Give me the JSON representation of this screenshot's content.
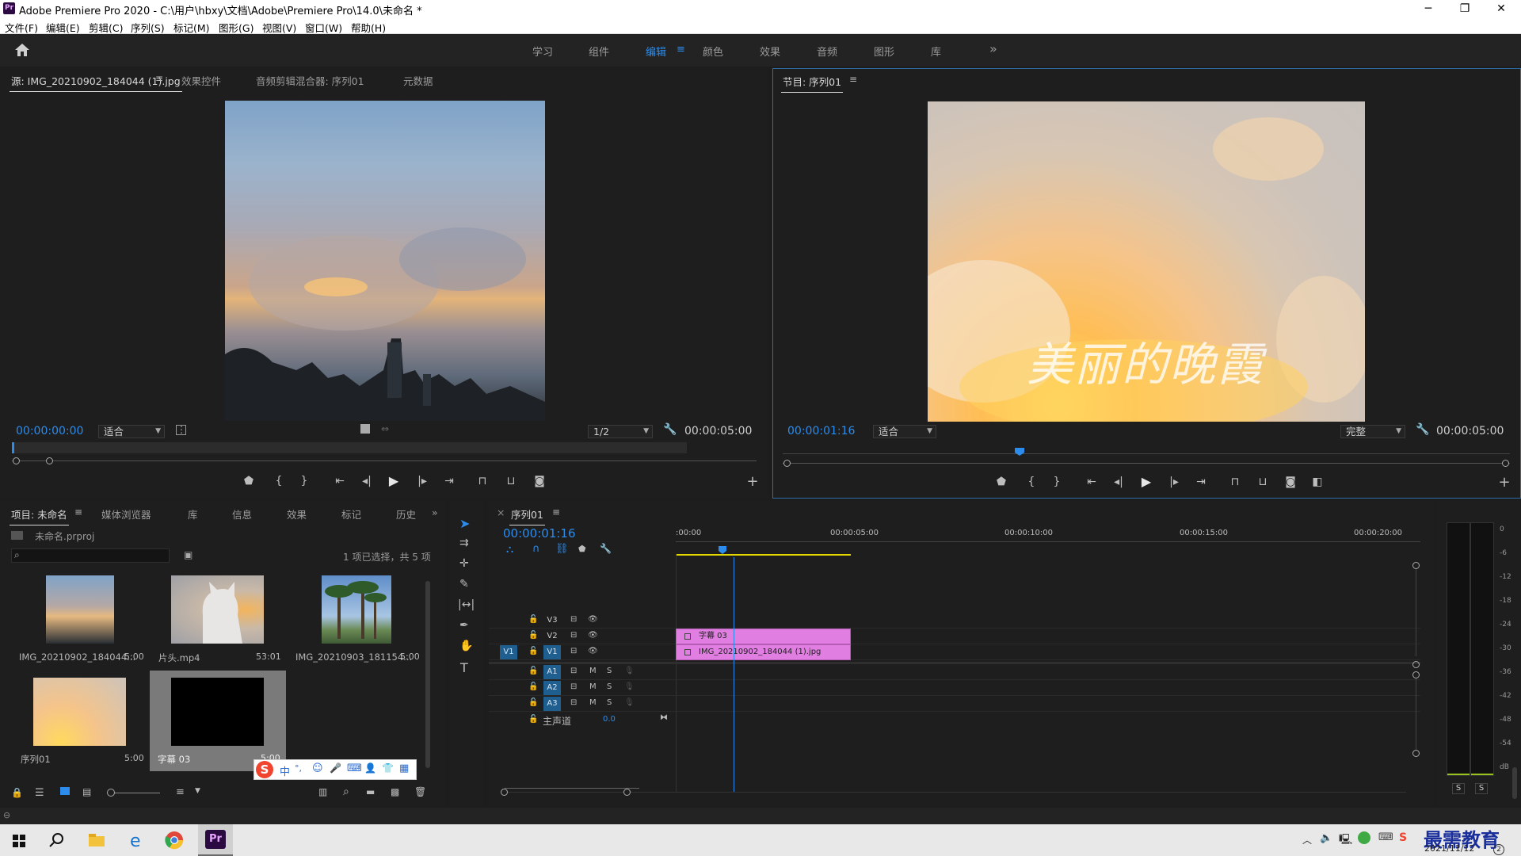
{
  "window": {
    "title": "Adobe Premiere Pro 2020 - C:\\用户\\hbxy\\文档\\Adobe\\Premiere Pro\\14.0\\未命名 *",
    "logo": "Pr",
    "minimize": "─",
    "restore": "❐",
    "close": "✕"
  },
  "menu": [
    "文件(F)",
    "编辑(E)",
    "剪辑(C)",
    "序列(S)",
    "标记(M)",
    "图形(G)",
    "视图(V)",
    "窗口(W)",
    "帮助(H)"
  ],
  "workspaces": {
    "items": [
      "学习",
      "组件",
      "编辑",
      "颜色",
      "效果",
      "音频",
      "图形",
      "库"
    ],
    "active": "编辑",
    "more": "»",
    "menu": "≡"
  },
  "source_panel": {
    "tabs": [
      "源: IMG_20210902_184044 (1).jpg",
      "效果控件",
      "音频剪辑混合器: 序列01",
      "元数据"
    ],
    "timecode": "00:00:00:00",
    "fit": "适合",
    "resolution": "1/2",
    "duration": "00:00:05:00"
  },
  "program_panel": {
    "tab": "节目: 序列01",
    "timecode": "00:00:01:16",
    "fit": "适合",
    "quality": "完整",
    "duration": "00:00:05:00",
    "overlay_title": "美丽的晚霞"
  },
  "project_panel": {
    "tabs": [
      "项目: 未命名",
      "媒体浏览器",
      "库",
      "信息",
      "效果",
      "标记",
      "历史"
    ],
    "project_file": "未命名.prproj",
    "selection_info": "1 项已选择，共 5 项",
    "items": [
      {
        "name": "IMG_20210902_184044...",
        "duration": "5:00"
      },
      {
        "name": "片头.mp4",
        "duration": "53:01"
      },
      {
        "name": "IMG_20210903_181154...",
        "duration": "5:00"
      },
      {
        "name": "序列01",
        "duration": "5:00"
      },
      {
        "name": "字幕 03",
        "duration": "5:00"
      }
    ]
  },
  "ime_toolbar": {
    "logo": "S",
    "mode": "中",
    "punct": "°,",
    "icons": [
      "☺",
      "🎤",
      "⌨",
      "👤",
      "👕",
      "▦"
    ]
  },
  "timeline": {
    "tab": "序列01",
    "timecode": "00:00:01:16",
    "ruler": [
      ":00:00",
      "00:00:05:00",
      "00:00:10:00",
      "00:00:15:00",
      "00:00:20:00"
    ],
    "video_tracks": [
      "V3",
      "V2",
      "V1"
    ],
    "audio_tracks": [
      "A1",
      "A2",
      "A3"
    ],
    "source_patch": "V1",
    "master": {
      "label": "主声道",
      "value": "0.0"
    },
    "mute": "M",
    "solo": "S",
    "clips": [
      {
        "track": "V2",
        "name": "字幕 03"
      },
      {
        "track": "V1",
        "name": "IMG_20210902_184044 (1).jpg"
      }
    ]
  },
  "audio_meter": {
    "scale": [
      "0",
      "-6",
      "-12",
      "-18",
      "-24",
      "-30",
      "-36",
      "-42",
      "-48",
      "-54",
      "dB"
    ],
    "solo_left": "S",
    "solo_right": "S"
  },
  "taskbar": {
    "date": "2021/11/12",
    "watermark": "最需教育",
    "notification_count": "2"
  }
}
